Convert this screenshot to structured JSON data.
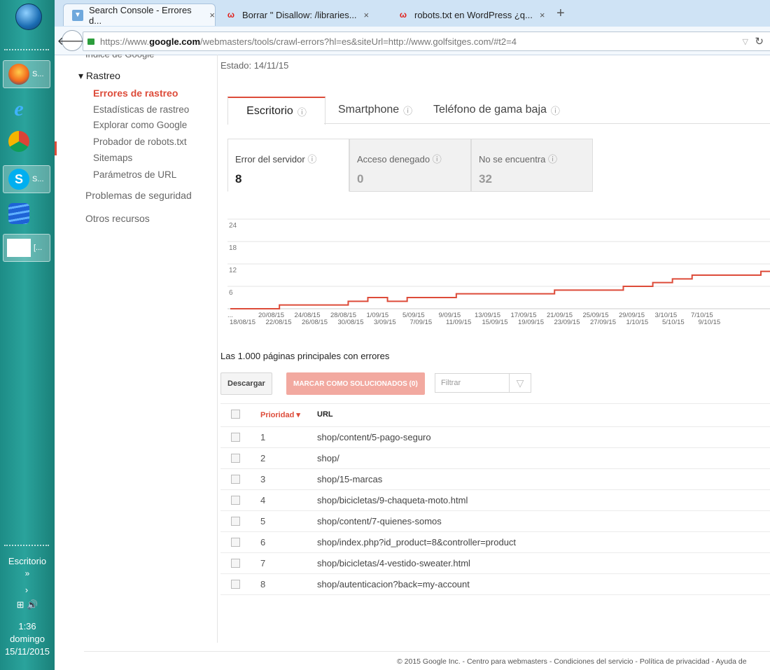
{
  "taskbar": {
    "apps": [
      {
        "name": "start-orb",
        "label": ""
      },
      {
        "name": "firefox",
        "label": "S..."
      },
      {
        "name": "internet-explorer",
        "label": ""
      },
      {
        "name": "chrome",
        "label": ""
      },
      {
        "name": "skype",
        "label": "S..."
      },
      {
        "name": "stack-app",
        "label": ""
      },
      {
        "name": "blank-window",
        "label": "[..."
      }
    ],
    "desktop_label": "Escritorio",
    "chevron": "»",
    "arrow": "›",
    "tray_icons": "⊞ 🔊",
    "time": "1:36",
    "day": "domingo",
    "date": "15/11/2015",
    "colors": {
      "bg": "#2aa39c"
    }
  },
  "browser": {
    "tabs": [
      {
        "title": "Search Console - Errores d...",
        "favicon": "sc-icon",
        "active": true
      },
      {
        "title": "Borrar \" Disallow: /libraries...",
        "favicon": "w-icon",
        "active": false
      },
      {
        "title": "robots.txt en WordPress ¿q...",
        "favicon": "w-icon",
        "active": false
      }
    ],
    "close_glyph": "×",
    "newtab_glyph": "+",
    "url": {
      "scheme": "https://www.",
      "host": "google.com",
      "path": "/webmasters/tools/crawl-errors?hl=es&siteUrl=http://www.golfsitges.com/#t2=4"
    }
  },
  "nav": {
    "cut_item": "Índice de Google",
    "section": "▾ Rastreo",
    "items": [
      {
        "label": "Errores de rastreo",
        "active": true
      },
      {
        "label": "Estadísticas de rastreo",
        "active": false
      },
      {
        "label": "Explorar como Google",
        "active": false
      },
      {
        "label": "Probador de robots.txt",
        "active": false
      },
      {
        "label": "Sitemaps",
        "active": false
      },
      {
        "label": "Parámetros de URL",
        "active": false
      }
    ],
    "top_items": [
      "Problemas de seguridad",
      "Otros recursos"
    ]
  },
  "main": {
    "status": "Estado: 14/11/15",
    "device_tabs": [
      {
        "label": "Escritorio",
        "active": true
      },
      {
        "label": "Smartphone",
        "active": false
      },
      {
        "label": "Teléfono de gama baja",
        "active": false
      }
    ],
    "help_glyph": "?",
    "stats": [
      {
        "label": "Error del servidor",
        "value": "8",
        "selected": true
      },
      {
        "label": "Acceso denegado",
        "value": "0",
        "selected": false
      },
      {
        "label": "No se encuentra",
        "value": "32",
        "selected": false
      }
    ],
    "table_title": "Las 1.000 páginas principales con errores",
    "download_label": "Descargar",
    "mark_label": "MARCAR COMO SOLUCIONADOS (0)",
    "filter_placeholder": "Filtrar",
    "filter_icon": "funnel-icon",
    "table": {
      "headers": {
        "priority": "Prioridad ▾",
        "url": "URL"
      },
      "rows": [
        {
          "priority": "1",
          "url": "shop/content/5-pago-seguro"
        },
        {
          "priority": "2",
          "url": "shop/"
        },
        {
          "priority": "3",
          "url": "shop/15-marcas"
        },
        {
          "priority": "4",
          "url": "shop/bicicletas/9-chaqueta-moto.html"
        },
        {
          "priority": "5",
          "url": "shop/content/7-quienes-somos"
        },
        {
          "priority": "6",
          "url": "shop/index.php?id_product=8&controller=product"
        },
        {
          "priority": "7",
          "url": "shop/bicicletas/4-vestido-sweater.html"
        },
        {
          "priority": "8",
          "url": "shop/autenticacion?back=my-account"
        }
      ]
    },
    "footer": "© 2015 Google Inc. - Centro para webmasters - Condiciones del servicio - Política de privacidad - Ayuda de"
  },
  "chart_data": {
    "type": "line",
    "title": "",
    "xlabel": "",
    "ylabel": "",
    "ylim": [
      0,
      24
    ],
    "yticks": [
      6,
      12,
      18,
      24
    ],
    "grid": true,
    "color": "#dd4b39",
    "xticks_upper": [
      "...",
      "20/08/15",
      "24/08/15",
      "28/08/15",
      "1/09/15",
      "5/09/15",
      "9/09/15",
      "13/09/15",
      "17/09/15",
      "21/09/15",
      "25/09/15",
      "29/09/15",
      "3/10/15",
      "7/10/15"
    ],
    "xticks_lower": [
      "18/08/15",
      "22/08/15",
      "26/08/15",
      "30/08/15",
      "3/09/15",
      "7/09/15",
      "11/09/15",
      "15/09/15",
      "19/09/15",
      "23/09/15",
      "27/09/15",
      "1/10/15",
      "5/10/15",
      "9/10/15"
    ],
    "x": [
      "16/08/15",
      "17/08/15",
      "18/08/15",
      "19/08/15",
      "20/08/15",
      "21/08/15",
      "22/08/15",
      "23/08/15",
      "24/08/15",
      "25/08/15",
      "26/08/15",
      "27/08/15",
      "28/08/15",
      "29/08/15",
      "30/08/15",
      "31/08/15",
      "1/09/15",
      "2/09/15",
      "3/09/15",
      "4/09/15",
      "5/09/15",
      "6/09/15",
      "7/09/15",
      "8/09/15",
      "9/09/15",
      "10/09/15",
      "11/09/15",
      "12/09/15",
      "13/09/15",
      "14/09/15",
      "15/09/15",
      "16/09/15",
      "17/09/15",
      "18/09/15",
      "19/09/15",
      "20/09/15",
      "21/09/15",
      "22/09/15",
      "23/09/15",
      "24/09/15",
      "25/09/15",
      "26/09/15",
      "27/09/15",
      "28/09/15",
      "29/09/15",
      "30/09/15",
      "1/10/15",
      "2/10/15",
      "3/10/15",
      "4/10/15",
      "5/10/15",
      "6/10/15",
      "7/10/15",
      "8/10/15",
      "9/10/15",
      "10/10/15"
    ],
    "values": [
      0,
      0,
      0,
      0,
      0,
      1,
      1,
      1,
      1,
      1,
      1,
      1,
      2,
      2,
      3,
      3,
      2,
      2,
      3,
      3,
      3,
      3,
      3,
      4,
      4,
      4,
      4,
      4,
      4,
      4,
      4,
      4,
      4,
      5,
      5,
      5,
      5,
      5,
      5,
      5,
      6,
      6,
      6,
      7,
      7,
      8,
      8,
      9,
      9,
      9,
      9,
      9,
      9,
      9,
      10,
      12
    ]
  }
}
